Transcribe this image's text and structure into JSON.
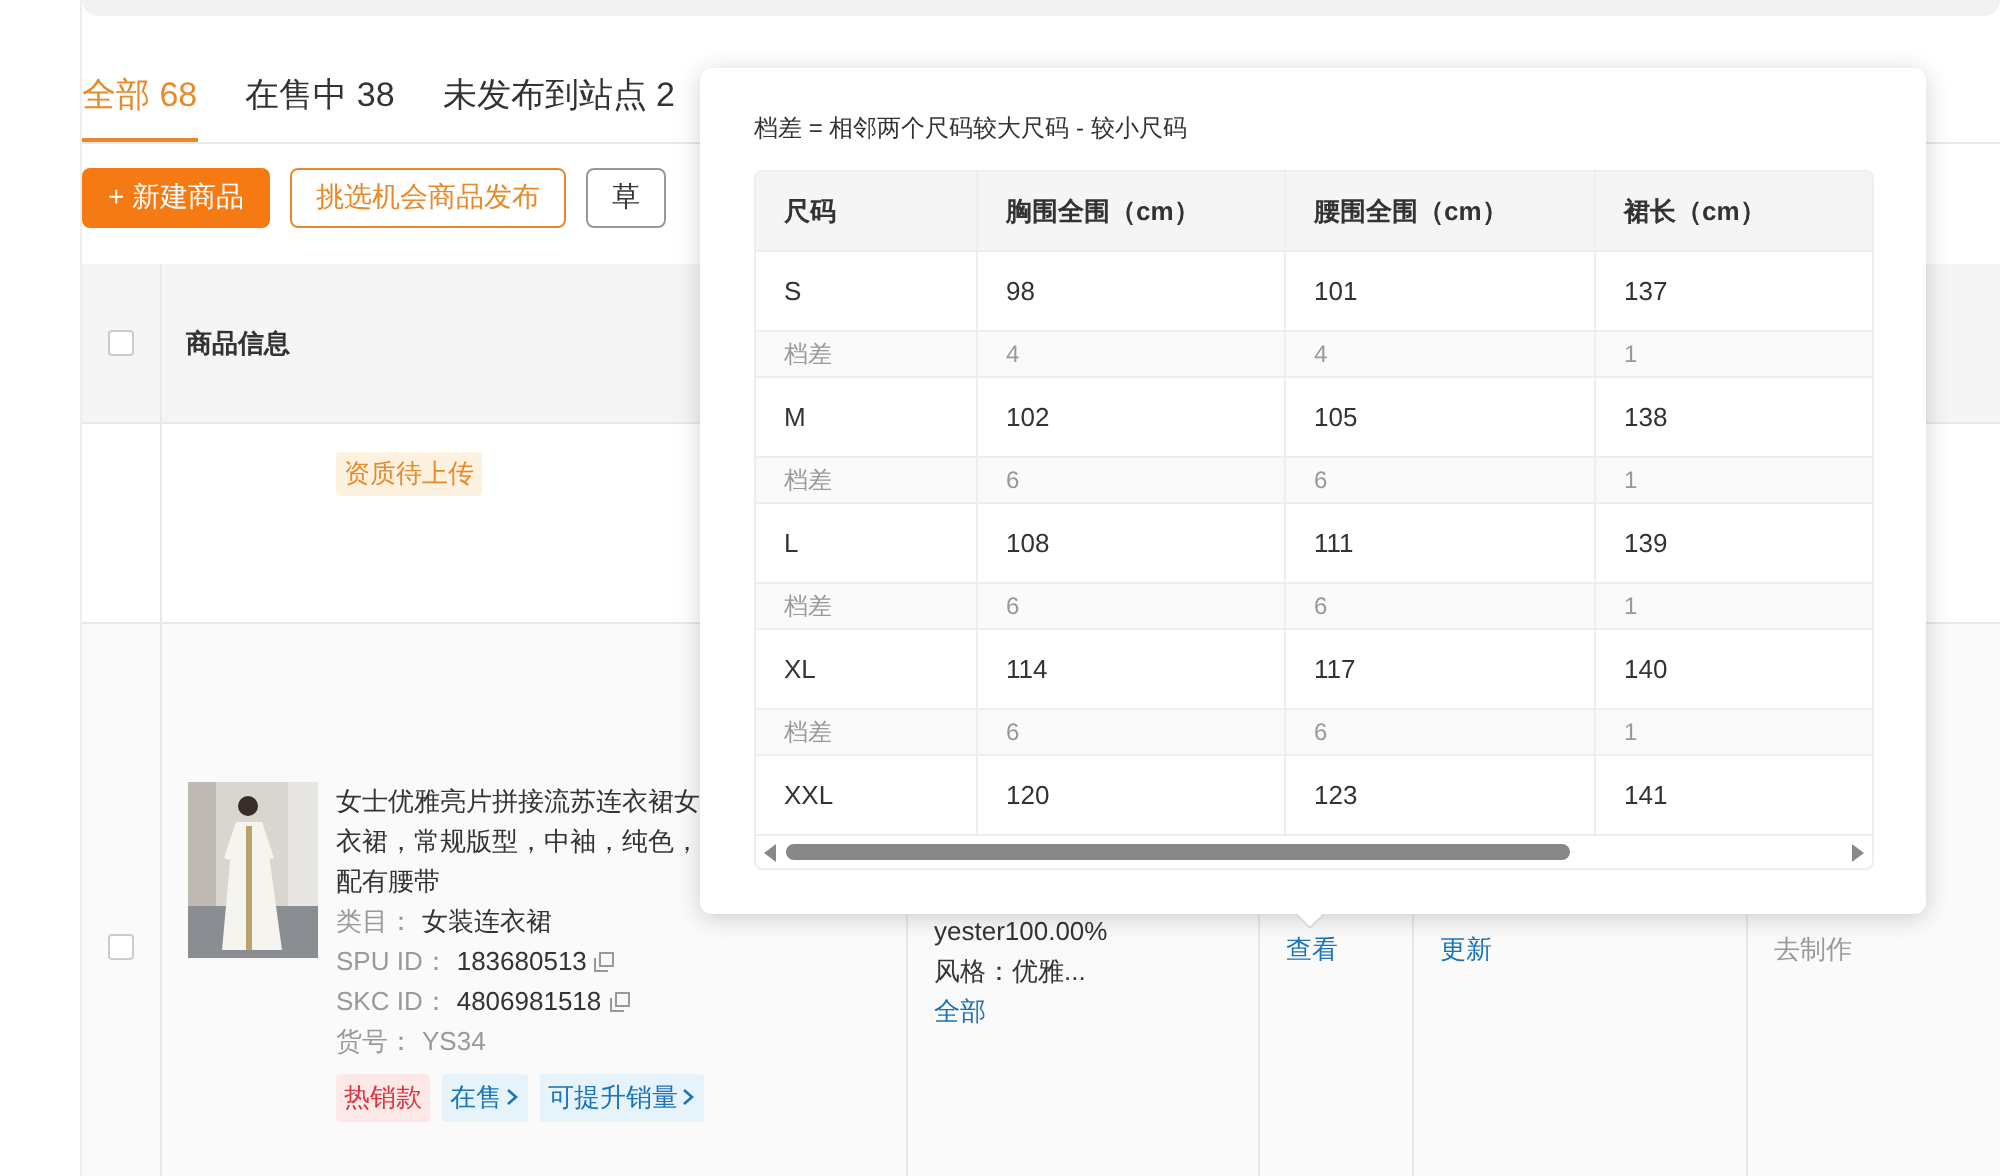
{
  "tabs": [
    {
      "label": "全部 68",
      "selected": true
    },
    {
      "label": "在售中 38",
      "selected": false
    },
    {
      "label": "未发布到站点 2",
      "selected": false
    }
  ],
  "actions": [
    {
      "label": "+ 新建商品",
      "kind": "primary"
    },
    {
      "label": "挑选机会商品发布",
      "kind": "outline"
    },
    {
      "label": "草",
      "kind": "default"
    }
  ],
  "table": {
    "header_checkbox": {
      "checked": false
    },
    "header_label": "商品信息",
    "rows": [
      {
        "tags": [
          {
            "label": "资质待上传",
            "kind": "warning"
          }
        ]
      },
      {
        "checked": false,
        "product": {
          "title_lines": [
            "女士优雅亮片拼接流苏连衣裙女",
            "衣裙，常规版型，中袖，纯色，",
            "配有腰带"
          ],
          "category_label": "类目：",
          "category": "女装连衣裙",
          "spu_label": "SPU ID：",
          "spu": "183680513",
          "skc_label": "SKC ID：",
          "skc": "4806981518",
          "sku_label": "货号：",
          "sku": "YS34",
          "tags": [
            {
              "label": "热销款",
              "kind": "hot"
            },
            {
              "label": "在售",
              "kind": "link"
            },
            {
              "label": "可提升销量",
              "kind": "link"
            }
          ]
        },
        "attributes": [
          "yester100.00%",
          "风格：优雅..."
        ],
        "attributes_link": "全部",
        "size_chart_link": "查看",
        "update_link": "更新",
        "make_link": {
          "label": "去制作",
          "disabled": true
        }
      }
    ]
  },
  "size_chart": {
    "note": "档差 = 相邻两个尺码较大尺码 - 较小尺码",
    "columns": [
      "尺码",
      "胸围全围（cm）",
      "腰围全围（cm）",
      "裙长（cm）"
    ],
    "rows": [
      {
        "kind": "size",
        "cells": [
          "S",
          "98",
          "101",
          "137"
        ]
      },
      {
        "kind": "diff",
        "cells": [
          "档差",
          "4",
          "4",
          "1"
        ]
      },
      {
        "kind": "size",
        "cells": [
          "M",
          "102",
          "105",
          "138"
        ]
      },
      {
        "kind": "diff",
        "cells": [
          "档差",
          "6",
          "6",
          "1"
        ]
      },
      {
        "kind": "size",
        "cells": [
          "L",
          "108",
          "111",
          "139"
        ]
      },
      {
        "kind": "diff",
        "cells": [
          "档差",
          "6",
          "6",
          "1"
        ]
      },
      {
        "kind": "size",
        "cells": [
          "XL",
          "114",
          "117",
          "140"
        ]
      },
      {
        "kind": "diff",
        "cells": [
          "档差",
          "6",
          "6",
          "1"
        ]
      },
      {
        "kind": "size",
        "cells": [
          "XXL",
          "120",
          "123",
          "141"
        ]
      }
    ]
  }
}
